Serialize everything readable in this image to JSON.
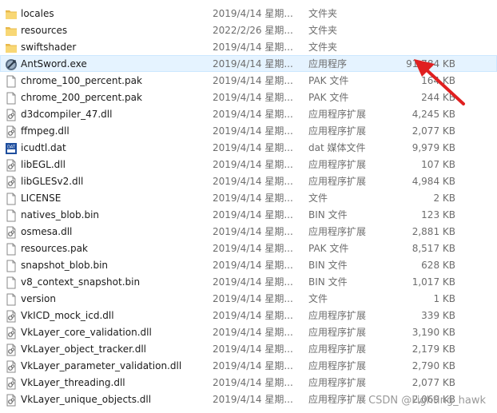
{
  "files": [
    {
      "name": "locales",
      "date": "2019/4/14 星期...",
      "type": "文件夹",
      "size": "",
      "icon": "folder-icon"
    },
    {
      "name": "resources",
      "date": "2022/2/26 星期...",
      "type": "文件夹",
      "size": "",
      "icon": "folder-icon"
    },
    {
      "name": "swiftshader",
      "date": "2019/4/14 星期...",
      "type": "文件夹",
      "size": "",
      "icon": "folder-icon"
    },
    {
      "name": "AntSword.exe",
      "date": "2019/4/14 星期...",
      "type": "应用程序",
      "size": "91,784 KB",
      "icon": "app-exe-icon",
      "selected": true
    },
    {
      "name": "chrome_100_percent.pak",
      "date": "2019/4/14 星期...",
      "type": "PAK 文件",
      "size": "164 KB",
      "icon": "file-icon"
    },
    {
      "name": "chrome_200_percent.pak",
      "date": "2019/4/14 星期...",
      "type": "PAK 文件",
      "size": "244 KB",
      "icon": "file-icon"
    },
    {
      "name": "d3dcompiler_47.dll",
      "date": "2019/4/14 星期...",
      "type": "应用程序扩展",
      "size": "4,245 KB",
      "icon": "dll-icon"
    },
    {
      "name": "ffmpeg.dll",
      "date": "2019/4/14 星期...",
      "type": "应用程序扩展",
      "size": "2,077 KB",
      "icon": "dll-icon"
    },
    {
      "name": "icudtl.dat",
      "date": "2019/4/14 星期...",
      "type": "dat 媒体文件",
      "size": "9,979 KB",
      "icon": "dat-file-icon"
    },
    {
      "name": "libEGL.dll",
      "date": "2019/4/14 星期...",
      "type": "应用程序扩展",
      "size": "107 KB",
      "icon": "dll-icon"
    },
    {
      "name": "libGLESv2.dll",
      "date": "2019/4/14 星期...",
      "type": "应用程序扩展",
      "size": "4,984 KB",
      "icon": "dll-icon"
    },
    {
      "name": "LICENSE",
      "date": "2019/4/14 星期...",
      "type": "文件",
      "size": "2 KB",
      "icon": "file-icon"
    },
    {
      "name": "natives_blob.bin",
      "date": "2019/4/14 星期...",
      "type": "BIN 文件",
      "size": "123 KB",
      "icon": "file-icon"
    },
    {
      "name": "osmesa.dll",
      "date": "2019/4/14 星期...",
      "type": "应用程序扩展",
      "size": "2,881 KB",
      "icon": "dll-icon"
    },
    {
      "name": "resources.pak",
      "date": "2019/4/14 星期...",
      "type": "PAK 文件",
      "size": "8,517 KB",
      "icon": "file-icon"
    },
    {
      "name": "snapshot_blob.bin",
      "date": "2019/4/14 星期...",
      "type": "BIN 文件",
      "size": "628 KB",
      "icon": "file-icon"
    },
    {
      "name": "v8_context_snapshot.bin",
      "date": "2019/4/14 星期...",
      "type": "BIN 文件",
      "size": "1,017 KB",
      "icon": "file-icon"
    },
    {
      "name": "version",
      "date": "2019/4/14 星期...",
      "type": "文件",
      "size": "1 KB",
      "icon": "file-icon"
    },
    {
      "name": "VkICD_mock_icd.dll",
      "date": "2019/4/14 星期...",
      "type": "应用程序扩展",
      "size": "339 KB",
      "icon": "dll-icon"
    },
    {
      "name": "VkLayer_core_validation.dll",
      "date": "2019/4/14 星期...",
      "type": "应用程序扩展",
      "size": "3,190 KB",
      "icon": "dll-icon"
    },
    {
      "name": "VkLayer_object_tracker.dll",
      "date": "2019/4/14 星期...",
      "type": "应用程序扩展",
      "size": "2,179 KB",
      "icon": "dll-icon"
    },
    {
      "name": "VkLayer_parameter_validation.dll",
      "date": "2019/4/14 星期...",
      "type": "应用程序扩展",
      "size": "2,790 KB",
      "icon": "dll-icon"
    },
    {
      "name": "VkLayer_threading.dll",
      "date": "2019/4/14 星期...",
      "type": "应用程序扩展",
      "size": "2,077 KB",
      "icon": "dll-icon"
    },
    {
      "name": "VkLayer_unique_objects.dll",
      "date": "2019/4/14 星期...",
      "type": "应用程序扩展",
      "size": "2,069 KB",
      "icon": "dll-icon"
    }
  ],
  "watermark": "CSDN @Fighting_hawk",
  "colors": {
    "selection": "#e5f3ff",
    "folder": "#f8d775",
    "arrow": "#e02020"
  }
}
